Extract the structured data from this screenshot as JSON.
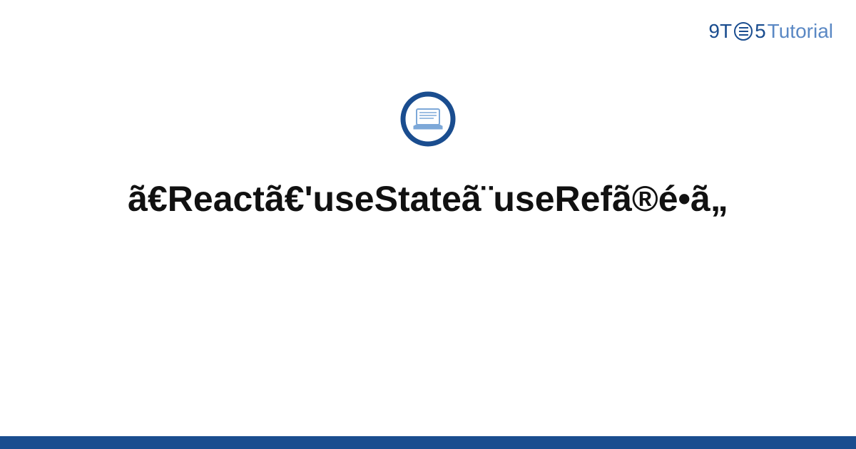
{
  "logo": {
    "part1": "9T",
    "part2": "5",
    "part3": "Tutorial"
  },
  "title": "ã€Reactã€'useStateã¨useRefã®é•ã„",
  "colors": {
    "brand_dark": "#1a4d8f",
    "brand_light": "#5a88c4"
  }
}
